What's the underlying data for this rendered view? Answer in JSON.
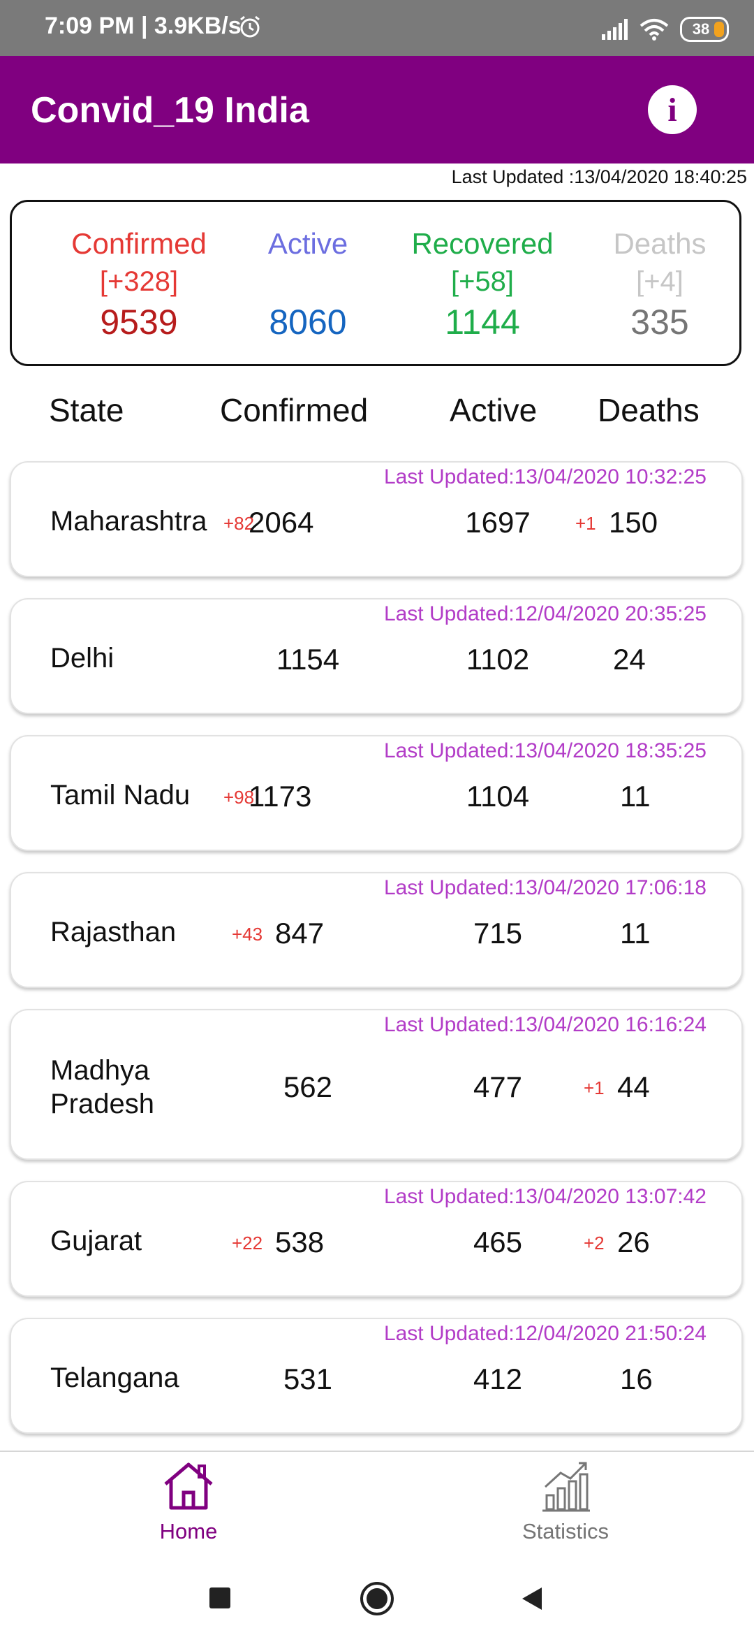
{
  "status_bar": {
    "time": "7:09 PM | 3.9KB/s",
    "battery": "38"
  },
  "app_bar": {
    "title": "Convid_19 India"
  },
  "last_updated": "Last Updated :13/04/2020 18:40:25",
  "summary": {
    "confirmed": {
      "label": "Confirmed",
      "delta": "[+328]",
      "value": "9539"
    },
    "active": {
      "label": "Active",
      "delta": "",
      "value": "8060"
    },
    "recovered": {
      "label": "Recovered",
      "delta": "[+58]",
      "value": "1144"
    },
    "deaths": {
      "label": "Deaths",
      "delta": "[+4]",
      "value": "335"
    }
  },
  "table_header": {
    "state": "State",
    "confirmed": "Confirmed",
    "active": "Active",
    "deaths": "Deaths"
  },
  "rows": [
    {
      "updated": "Last Updated:13/04/2020 10:32:25",
      "state": "Maharashtra",
      "confirmed_inc": "+82",
      "confirmed": "2064",
      "active": "1697",
      "deaths_inc": "+1",
      "deaths": "150"
    },
    {
      "updated": "Last Updated:12/04/2020 20:35:25",
      "state": "Delhi",
      "confirmed_inc": "",
      "confirmed": "1154",
      "active": "1102",
      "deaths_inc": "",
      "deaths": "24"
    },
    {
      "updated": "Last Updated:13/04/2020 18:35:25",
      "state": "Tamil Nadu",
      "confirmed_inc": "+98",
      "confirmed": "1173",
      "active": "1104",
      "deaths_inc": "",
      "deaths": "11"
    },
    {
      "updated": "Last Updated:13/04/2020 17:06:18",
      "state": "Rajasthan",
      "confirmed_inc": "+43",
      "confirmed": "847",
      "active": "715",
      "deaths_inc": "",
      "deaths": "11"
    },
    {
      "updated": "Last Updated:13/04/2020 16:16:24",
      "state_line1": "Madhya",
      "state_line2": "Pradesh",
      "confirmed_inc": "",
      "confirmed": "562",
      "active": "477",
      "deaths_inc": "+1",
      "deaths": "44"
    },
    {
      "updated": "Last Updated:13/04/2020 13:07:42",
      "state": "Gujarat",
      "confirmed_inc": "+22",
      "confirmed": "538",
      "active": "465",
      "deaths_inc": "+2",
      "deaths": "26"
    },
    {
      "updated": "Last Updated:12/04/2020 21:50:24",
      "state": "Telangana",
      "confirmed_inc": "",
      "confirmed": "531",
      "active": "412",
      "deaths_inc": "",
      "deaths": "16"
    }
  ],
  "bottom_nav": {
    "home": "Home",
    "statistics": "Statistics"
  },
  "colors": {
    "primary": "#800080",
    "confirmed": "#e53935",
    "active": "#1565c0",
    "recovered": "#1fad4a",
    "deaths": "#757575",
    "updated_text": "#b23cc7"
  },
  "icons": [
    "alarm-icon",
    "signal-icon",
    "wifi-icon",
    "battery-icon",
    "info-icon",
    "home-icon",
    "statistics-icon",
    "recents-icon",
    "system-home-icon",
    "back-icon"
  ]
}
